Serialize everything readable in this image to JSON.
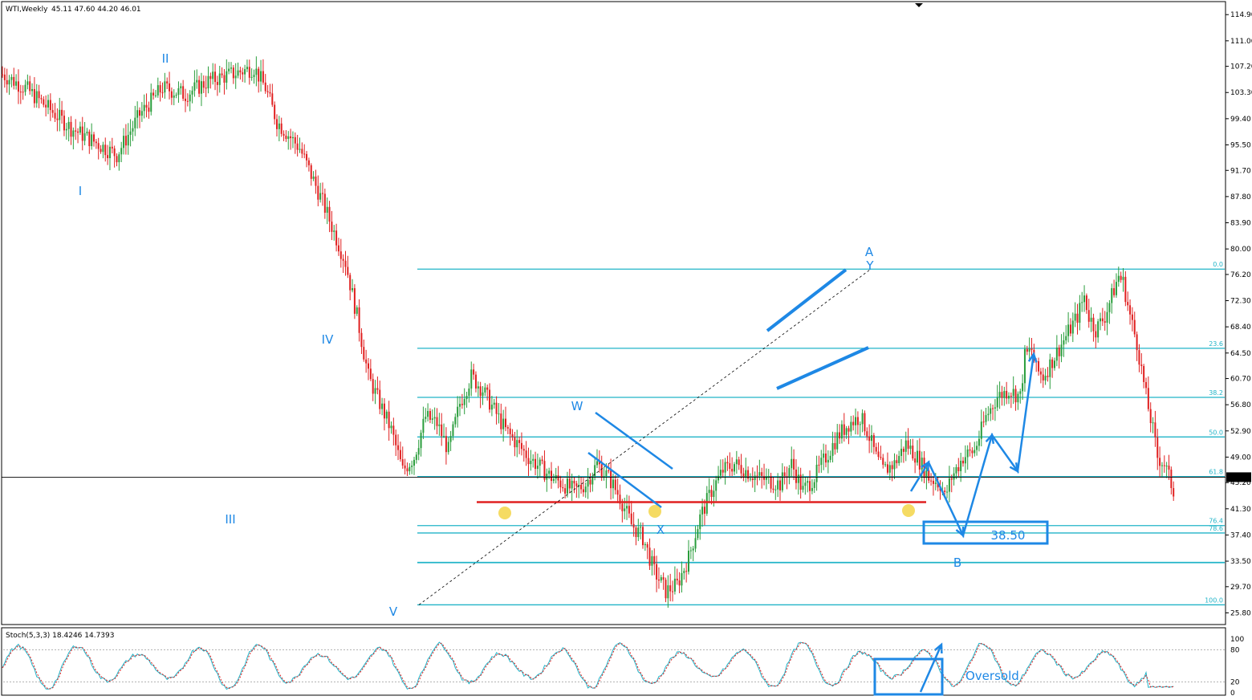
{
  "header": {
    "symbol": "WTI,Weekly",
    "ohlc": "45.11 47.60 44.20 46.01"
  },
  "colors": {
    "bull": "#2a9d3c",
    "bear": "#e02020",
    "fib": "#21b4c8",
    "annotation": "#1e88e5",
    "support": "#e02020",
    "marker": "#f2d23c",
    "stoch_main": "#21b4c8",
    "stoch_signal": "#e02020"
  },
  "chart_data": [
    {
      "type": "candlestick",
      "symbol": "WTI",
      "timeframe": "Weekly",
      "last_price": "46.01",
      "price_axis": {
        "ticks": [
          "114.90",
          "111.00",
          "107.20",
          "103.30",
          "99.40",
          "95.50",
          "91.70",
          "87.80",
          "83.90",
          "80.00",
          "76.20",
          "72.30",
          "68.40",
          "64.50",
          "60.70",
          "56.80",
          "52.90",
          "49.00",
          "45.20",
          "41.30",
          "37.40",
          "33.50",
          "29.70",
          "25.80"
        ],
        "range": [
          24.3,
          116.6
        ]
      },
      "close_path": [
        [
          0,
          106
        ],
        [
          10,
          104
        ],
        [
          20,
          101
        ],
        [
          30,
          98
        ],
        [
          40,
          96
        ],
        [
          50,
          94
        ],
        [
          55,
          97
        ],
        [
          60,
          100
        ],
        [
          70,
          104
        ],
        [
          80,
          103
        ],
        [
          90,
          105
        ],
        [
          100,
          106
        ],
        [
          110,
          107
        ],
        [
          115,
          104
        ],
        [
          120,
          99
        ],
        [
          130,
          95
        ],
        [
          140,
          87
        ],
        [
          150,
          78
        ],
        [
          155,
          70
        ],
        [
          160,
          61
        ],
        [
          165,
          57
        ],
        [
          170,
          53
        ],
        [
          175,
          47
        ],
        [
          180,
          49
        ],
        [
          185,
          55
        ],
        [
          190,
          54
        ],
        [
          195,
          50
        ],
        [
          200,
          57
        ],
        [
          205,
          61
        ],
        [
          210,
          59
        ],
        [
          220,
          53
        ],
        [
          230,
          49
        ],
        [
          240,
          46
        ],
        [
          250,
          44
        ],
        [
          255,
          45
        ],
        [
          260,
          48
        ],
        [
          265,
          46
        ],
        [
          270,
          43
        ],
        [
          275,
          39
        ],
        [
          280,
          37
        ],
        [
          285,
          32
        ],
        [
          290,
          29
        ],
        [
          295,
          30
        ],
        [
          300,
          34
        ],
        [
          305,
          40
        ],
        [
          310,
          44
        ],
        [
          315,
          47
        ],
        [
          320,
          48
        ],
        [
          330,
          46
        ],
        [
          340,
          45
        ],
        [
          345,
          48
        ],
        [
          350,
          44
        ],
        [
          355,
          46
        ],
        [
          360,
          49
        ],
        [
          365,
          52
        ],
        [
          370,
          54
        ],
        [
          375,
          55
        ],
        [
          378,
          53
        ],
        [
          382,
          49
        ],
        [
          385,
          47
        ],
        [
          390,
          48
        ],
        [
          395,
          51
        ],
        [
          400,
          49
        ],
        [
          405,
          46
        ],
        [
          410,
          45
        ],
        [
          412,
          43
        ],
        [
          415,
          46
        ],
        [
          420,
          49
        ],
        [
          425,
          50
        ],
        [
          430,
          55
        ],
        [
          435,
          58
        ],
        [
          440,
          59
        ],
        [
          445,
          58
        ],
        [
          447,
          64
        ],
        [
          450,
          65
        ],
        [
          452,
          62
        ],
        [
          455,
          61
        ],
        [
          460,
          64
        ],
        [
          465,
          67
        ],
        [
          470,
          70
        ],
        [
          473,
          73
        ],
        [
          475,
          70
        ],
        [
          478,
          68
        ],
        [
          482,
          70
        ],
        [
          485,
          73
        ],
        [
          488,
          76
        ],
        [
          490,
          75
        ],
        [
          493,
          70
        ],
        [
          496,
          66
        ],
        [
          500,
          58
        ],
        [
          503,
          53
        ],
        [
          505,
          49
        ],
        [
          508,
          48
        ],
        [
          510,
          46
        ],
        [
          512,
          44
        ]
      ],
      "wave_labels": [
        "I",
        "II",
        "III",
        "IV",
        "V",
        "W",
        "X",
        "Y",
        "A",
        "B"
      ],
      "fibonacci": {
        "levels": [
          "0.0",
          "23.6",
          "38.2",
          "50.0",
          "61.8",
          "76.4",
          "78.6",
          "100.0"
        ],
        "low": 27.0,
        "high": 77.0
      },
      "horizontal_lines": [
        {
          "name": "support",
          "price": 42.3
        },
        {
          "name": "level",
          "price": 33.3
        }
      ],
      "target": "38.50",
      "wave_b": "B"
    },
    {
      "type": "line",
      "title": "Stoch(5,3,3) 18.4246 14.7393",
      "y_ticks": [
        "100",
        "80",
        "20",
        "0"
      ],
      "ylim": [
        0,
        100
      ],
      "levels": [
        80,
        20
      ],
      "series": [
        {
          "name": "main",
          "color": "#21b4c8"
        },
        {
          "name": "signal",
          "color": "#e02020"
        }
      ],
      "annotation": "Oversold"
    }
  ]
}
